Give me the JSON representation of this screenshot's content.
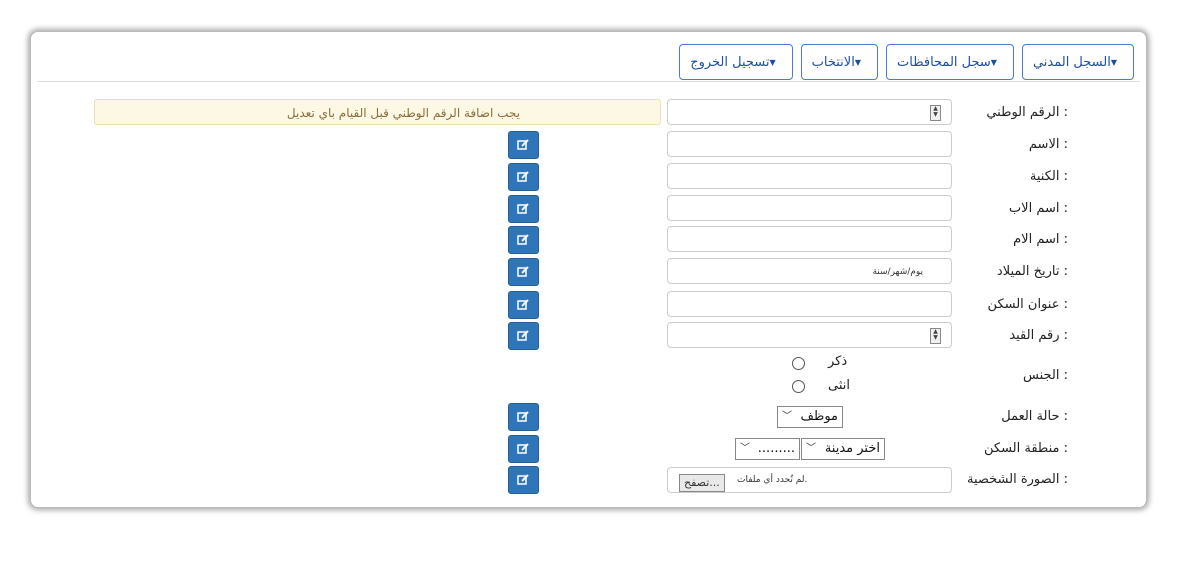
{
  "nav": [
    {
      "label": "السجل المدني"
    },
    {
      "label": "سجل المحافظات"
    },
    {
      "label": "الانتخاب"
    },
    {
      "label": "تسجيل الخروج"
    }
  ],
  "alert": "يجب اضافة الرقم الوطني قبل القيام باي تعديل",
  "fields": {
    "national_id": "الرقم الوطني :",
    "name": "الاسم :",
    "surname": "الكنية :",
    "father": "اسم الاب :",
    "mother": "اسم الام :",
    "birthdate": "تاريخ الميلاد :",
    "address": "عنوان السكن :",
    "record_no": "رقم القيد :",
    "gender": "الجنس :",
    "work": "حالة العمل :",
    "region": "منطقة السكن :",
    "photo": "الصورة الشخصية :"
  },
  "date_placeholder": "يوم/شهر/سنة",
  "gender_options": [
    "ذكر",
    "انثى"
  ],
  "work_value": "موظف",
  "city_value": "اختر مدينة",
  "area_value": ".........",
  "file_button": "تصفح...",
  "file_status": "لم تُحدد أي ملفات.",
  "icons": {
    "edit": "edit-icon",
    "caret": "caret-down-icon"
  }
}
